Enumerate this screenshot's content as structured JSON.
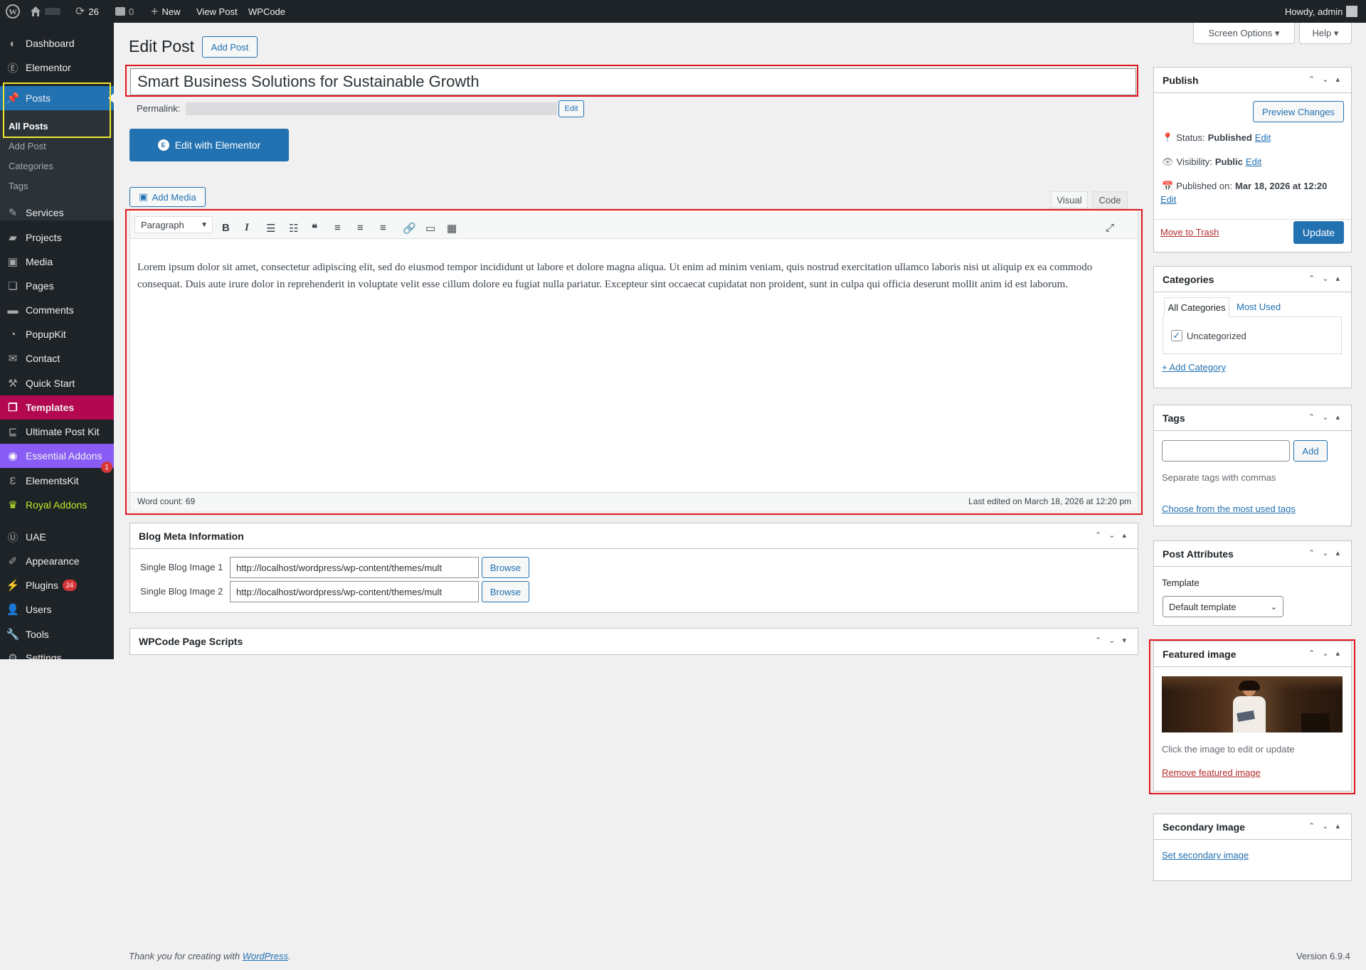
{
  "adminbar": {
    "updates_count": "26",
    "comments_count": "0",
    "new_label": "New",
    "view_post_label": "View Post",
    "wpcode_label": "WPCode",
    "howdy_label": "Howdy, admin"
  },
  "sidebar": {
    "items": [
      {
        "label": "Dashboard"
      },
      {
        "label": "Elementor"
      },
      {
        "label": "Posts"
      },
      {
        "label": "Services"
      },
      {
        "label": "Projects"
      },
      {
        "label": "Media"
      },
      {
        "label": "Pages"
      },
      {
        "label": "Comments"
      },
      {
        "label": "PopupKit"
      },
      {
        "label": "Contact"
      },
      {
        "label": "Quick Start"
      },
      {
        "label": "Templates"
      },
      {
        "label": "Ultimate Post Kit"
      },
      {
        "label": "Essential Addons",
        "badge": "1"
      },
      {
        "label": "ElementsKit"
      },
      {
        "label": "Royal Addons"
      },
      {
        "label": "UAE"
      },
      {
        "label": "Appearance"
      },
      {
        "label": "Plugins",
        "badge": "24"
      },
      {
        "label": "Users"
      },
      {
        "label": "Tools"
      },
      {
        "label": "Settings"
      }
    ],
    "posts_submenu": [
      "All Posts",
      "Add Post",
      "Categories",
      "Tags"
    ]
  },
  "header": {
    "screen_options": "Screen Options",
    "help": "Help",
    "page_title": "Edit Post",
    "add_post_button": "Add Post"
  },
  "editor": {
    "post_title": "Smart Business Solutions for Sustainable Growth",
    "permalink_label": "Permalink:",
    "permalink_edit": "Edit",
    "elementor_button": "Edit with Elementor",
    "add_media": "Add Media",
    "tab_visual": "Visual",
    "tab_code": "Code",
    "format_select": "Paragraph",
    "body_text": "Lorem ipsum dolor sit amet, consectetur adipiscing elit, sed do eiusmod tempor incididunt ut labore et dolore magna aliqua. Ut enim ad minim veniam, quis nostrud exercitation ullamco laboris nisi ut aliquip ex ea commodo consequat. Duis aute irure dolor in reprehenderit in voluptate velit esse cillum dolore eu fugiat nulla pariatur. Excepteur sint occaecat cupidatat non proident, sunt in culpa qui officia deserunt mollit anim id est laborum.",
    "word_count": "Word count: 69",
    "last_edited": "Last edited on March 18, 2026 at 12:20 pm"
  },
  "blog_meta": {
    "title": "Blog Meta Information",
    "image1_label": "Single Blog Image 1",
    "image1_value": "http://localhost/wordpress/wp-content/themes/mult",
    "image2_label": "Single Blog Image 2",
    "image2_value": "http://localhost/wordpress/wp-content/themes/mult",
    "browse": "Browse"
  },
  "wpcode_box": {
    "title": "WPCode Page Scripts"
  },
  "publish": {
    "title": "Publish",
    "preview": "Preview Changes",
    "status_label": "Status:",
    "status_value": "Published",
    "visibility_label": "Visibility:",
    "visibility_value": "Public",
    "published_label": "Published on:",
    "published_value": "Mar 18, 2026 at 12:20",
    "edit": "Edit",
    "trash": "Move to Trash",
    "update": "Update"
  },
  "categories": {
    "title": "Categories",
    "tab_all": "All Categories",
    "tab_most": "Most Used",
    "item": "Uncategorized",
    "add": "+ Add Category"
  },
  "tags": {
    "title": "Tags",
    "add": "Add",
    "hint": "Separate tags with commas",
    "choose": "Choose from the most used tags"
  },
  "post_attributes": {
    "title": "Post Attributes",
    "template_label": "Template",
    "template_value": "Default template"
  },
  "featured_image": {
    "title": "Featured image",
    "hint": "Click the image to edit or update",
    "remove": "Remove featured image"
  },
  "secondary_image": {
    "title": "Secondary Image",
    "set": "Set secondary image"
  },
  "footer": {
    "thanks": "Thank you for creating with",
    "wordpress": "WordPress",
    "version": "Version 6.9.4"
  },
  "colors": {
    "admin_dark": "#1d2327",
    "accent_blue": "#2271b1",
    "templates_bg": "#b3074f",
    "essential_bg": "#8a5cf6",
    "highlight_red": "#e3161d",
    "highlight_yellow": "#f0e630"
  }
}
